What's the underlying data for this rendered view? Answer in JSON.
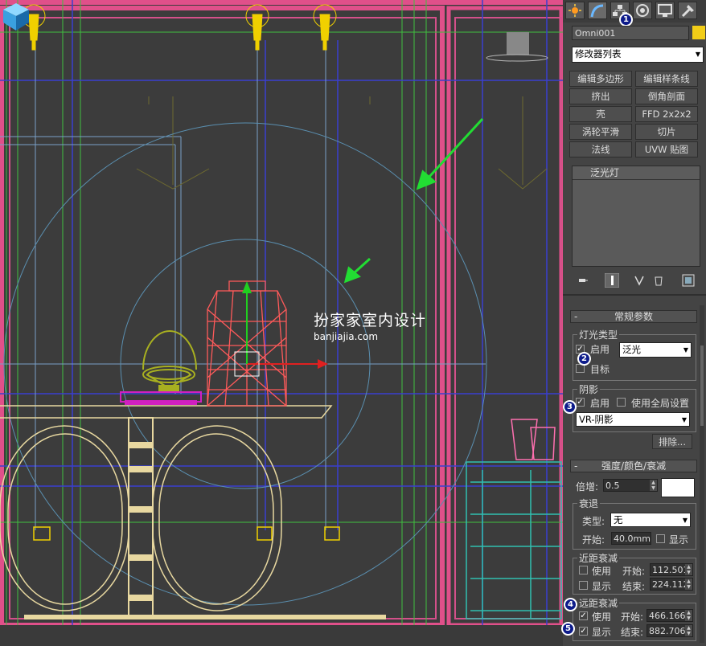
{
  "panel": {
    "object_name": "Omni001",
    "object_color": "#f2cd17",
    "modifier_list": "修改器列表",
    "modifier_buttons": [
      "编辑多边形",
      "编辑样条线",
      "挤出",
      "倒角剖面",
      "壳",
      "FFD 2x2x2",
      "涡轮平滑",
      "切片",
      "法线",
      "UVW 贴图"
    ],
    "stack_item": "泛光灯"
  },
  "general_params": {
    "rollout_title": "常规参数",
    "light_type_label": "灯光类型",
    "enable_label": "启用",
    "light_type_value": "泛光",
    "target_label": "目标",
    "shadows_label": "阴影",
    "shadows_enable_label": "启用",
    "use_global_label": "使用全局设置",
    "shadow_type": "VR-阴影",
    "exclude_button": "排除..."
  },
  "intensity": {
    "rollout_title": "强度/颜色/衰减",
    "multiplier_label": "倍增:",
    "multiplier_value": "0.5",
    "light_color": "#ffffff",
    "decay_label": "衰退",
    "type_label": "类型:",
    "type_value": "无",
    "start_label": "开始:",
    "start_value": "40.0mm",
    "show_label": "显示",
    "near_label": "近距衰减",
    "near_use_label": "使用",
    "near_start_label": "开始:",
    "near_start_value": "112.501",
    "near_show_label": "显示",
    "near_end_label": "结束:",
    "near_end_value": "224.112",
    "far_label": "远距衰减",
    "far_use_label": "使用",
    "far_start_label": "开始:",
    "far_start_value": "466.166",
    "far_show_label": "显示",
    "far_end_label": "结束:",
    "far_end_value": "882.706"
  },
  "badges": [
    "1",
    "2",
    "3",
    "4",
    "5"
  ],
  "watermark": {
    "cn": "扮家家室内设计",
    "en": "banjiajia.com"
  },
  "icons": [
    "sun-icon",
    "modify-icon",
    "hierarchy-icon",
    "motion-icon",
    "display-icon",
    "utilities-icon",
    "color-swatch-icon",
    "pin-stack-icon",
    "show-end-result-icon",
    "make-unique-icon",
    "remove-modifier-icon",
    "configure-sets-icon",
    "arrow-annotation-icon"
  ],
  "colors": {
    "accent_pink": "#e0508a",
    "badge_blue": "#0d1b8a",
    "arrow_green": "#22dd33"
  }
}
